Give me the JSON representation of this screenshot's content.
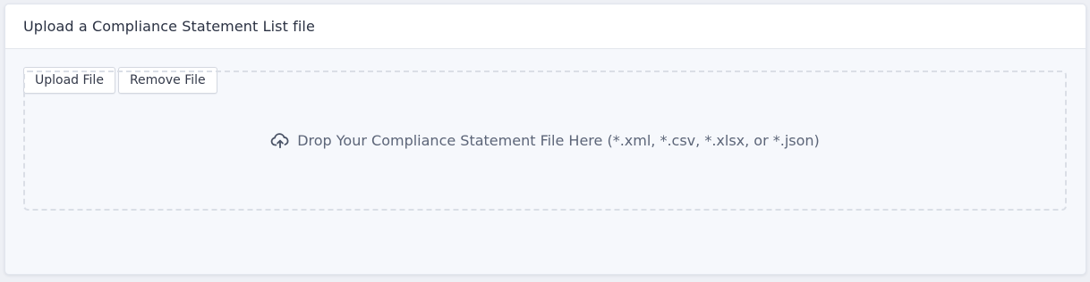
{
  "panel": {
    "title": "Upload a Compliance Statement List file"
  },
  "toolbar": {
    "upload_label": "Upload File",
    "remove_label": "Remove File"
  },
  "dropzone": {
    "icon": "cloud-upload-icon",
    "text": "Drop Your Compliance Statement File Here (*.xml, *.csv, *.xlsx, or *.json)"
  },
  "colors": {
    "background": "#f6f8fc",
    "header_background": "#ffffff",
    "text_primary": "#2a3142",
    "text_muted": "#5c6578",
    "dashed_border": "#dadee6"
  }
}
